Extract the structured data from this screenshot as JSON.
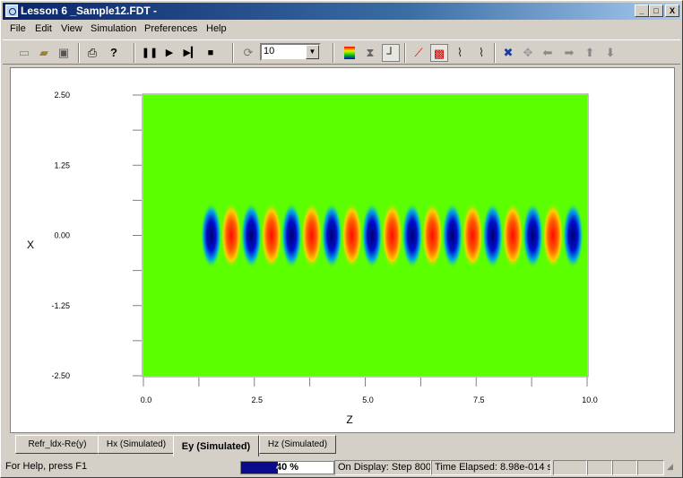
{
  "window": {
    "title": "Lesson 6 _Sample12.FDT -"
  },
  "caption_buttons": {
    "minimize": "_",
    "maximize": "□",
    "close": "X"
  },
  "menu": [
    "File",
    "Edit",
    "View",
    "Simulation",
    "Preferences",
    "Help"
  ],
  "toolbar": {
    "zoom_value": "10",
    "icons": [
      "new-file-icon",
      "open-folder-icon",
      "save-icon",
      "print-icon",
      "help-icon",
      "pause-icon",
      "play-icon",
      "step-forward-icon",
      "stop-icon",
      "refresh-icon",
      "color-palette-icon",
      "x-marker-icon",
      "axis-icon",
      "red-axis-icon",
      "grid-pattern-icon",
      "line-chart-icon",
      "chart-cross-icon",
      "zoom-in-icon",
      "zoom-fit-icon",
      "arrow-left-icon",
      "arrow-right-icon",
      "arrow-up-icon",
      "arrow-down-icon"
    ]
  },
  "chart_data": {
    "type": "heatmap",
    "xlabel": "Z",
    "ylabel": "X",
    "x_ticks": [
      "0.0",
      "2.5",
      "5.0",
      "7.5",
      "10.0"
    ],
    "y_ticks": [
      "2.50",
      "1.25",
      "0.00",
      "-1.25",
      "-2.50"
    ],
    "xlim": [
      0,
      10
    ],
    "ylim": [
      -2.5,
      2.5
    ],
    "background_color": "#5cff00",
    "field_start_z": 1.3,
    "beam_center_x": 0.0,
    "beam_half_width_x": 0.5,
    "cycles": 9.6,
    "colors": {
      "positive": "#ff1a00",
      "negative": "#00008c",
      "zero": "#5cff00"
    }
  },
  "tabs": [
    {
      "label": "Refr_ldx-Re(y)",
      "active": false
    },
    {
      "label": "Hx (Simulated)",
      "active": false
    },
    {
      "label": "Ey (Simulated)",
      "active": true
    },
    {
      "label": "Hz (Simulated)",
      "active": false
    }
  ],
  "status": {
    "help": "For Help, press F1",
    "progress_percent": 40,
    "progress_label": "40 %",
    "display": "On Display: Step 800",
    "elapsed": "Time Elapsed: 8.98e-014 s"
  }
}
